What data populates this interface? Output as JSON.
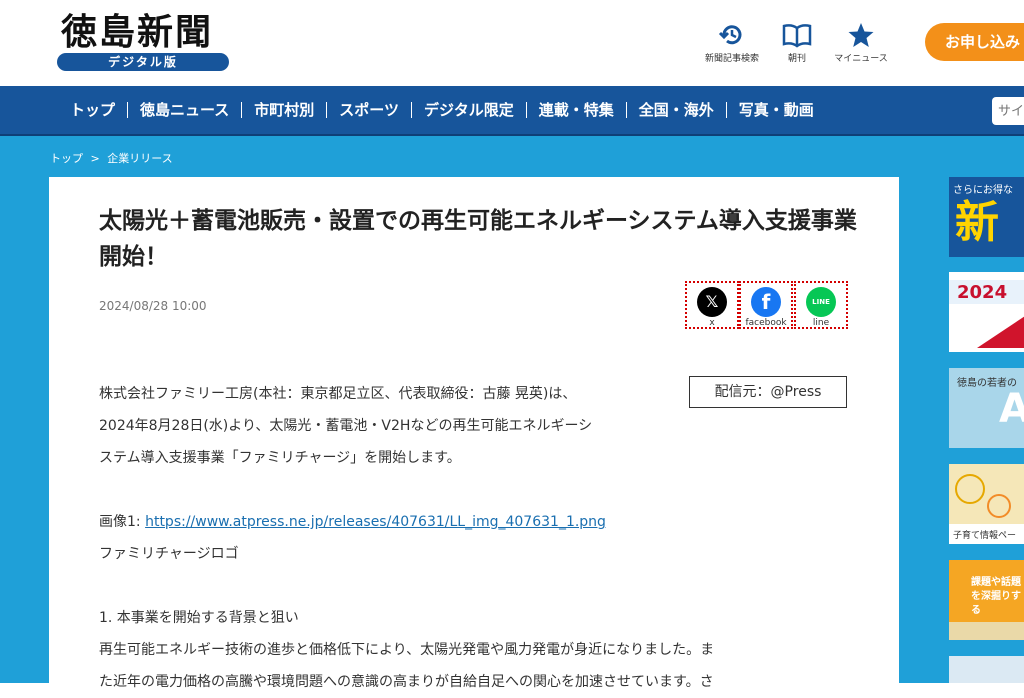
{
  "header": {
    "logo_title": "徳島新聞",
    "logo_sub": "デジタル版",
    "icons": [
      {
        "label": "新聞記事検索",
        "icon": "history-icon"
      },
      {
        "label": "朝刊",
        "icon": "book-icon"
      },
      {
        "label": "マイニュース",
        "icon": "star-icon"
      }
    ],
    "apply_label": "お申し込み"
  },
  "nav": {
    "items": [
      "トップ",
      "徳島ニュース",
      "市町村別",
      "スポーツ",
      "デジタル限定",
      "連載・特集",
      "全国・海外",
      "写真・動画"
    ],
    "search_placeholder": "サイト"
  },
  "breadcrumb": {
    "home": "トップ",
    "separator": ">",
    "current": "企業リリース"
  },
  "article": {
    "title": "太陽光＋蓄電池販売・設置での再生可能エネルギーシステム導入支援事業開始！",
    "date": "2024/08/28 10:00",
    "share": [
      {
        "label": "x",
        "glyph": "𝕏"
      },
      {
        "label": "facebook",
        "glyph": "f"
      },
      {
        "label": "line",
        "glyph": "LINE"
      }
    ],
    "source": "配信元：@Press",
    "intro": [
      "株式会社ファミリー工房(本社：東京都足立区、代表取締役：古藤 晃英)は、",
      "2024年8月28日(水)より、太陽光・蓄電池・V2Hなどの再生可能エネルギーシ",
      "ステム導入支援事業「ファミリチャージ」を開始します。"
    ],
    "image_prefix": "画像1: ",
    "image_link": "https://www.atpress.ne.jp/releases/407631/LL_img_407631_1.png",
    "image_caption": "ファミリチャージロゴ",
    "section_heading": "1. 本事業を開始する背景と狙い",
    "section_lines": [
      "再生可能エネルギー技術の進歩と価格低下により、太陽光発電や風力発電が身近になりました。ま",
      "た近年の電力価格の高騰や環境問題への意識の高まりが自給自足への関心を加速させています。さ"
    ]
  },
  "ads": {
    "ad1_top": "さらにお得な",
    "ad1_big": "新",
    "ad2_text": "2024",
    "ad3_text": "徳島の若者の",
    "ad3_big": "A",
    "ad4_text": "子育て情報ペー",
    "ad5_text": "課題や話題を深掘りする"
  }
}
